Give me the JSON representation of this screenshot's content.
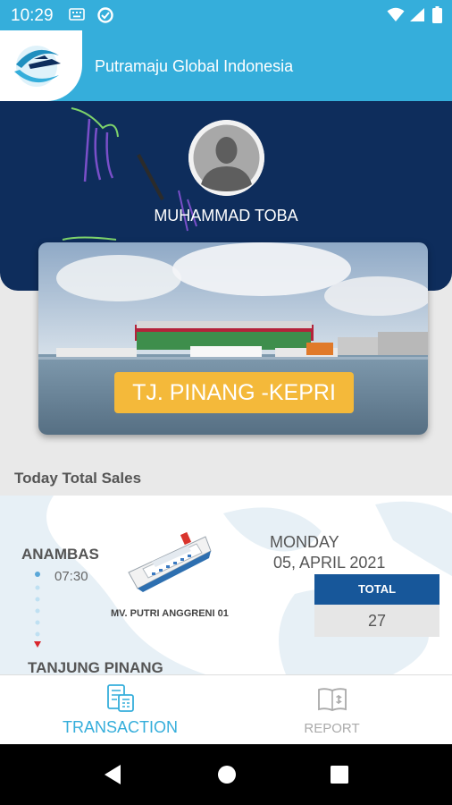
{
  "status_bar": {
    "time": "10:29",
    "icons": [
      "keyboard-icon",
      "data-saver-icon",
      "wifi-icon",
      "signal-icon",
      "battery-icon"
    ]
  },
  "app_bar": {
    "title": "Putramaju Global Indonesia",
    "logo": "ship-logo-icon"
  },
  "profile": {
    "name": "MUHAMMAD TOBA",
    "avatar_icon": "user-silhouette-icon"
  },
  "route_card": {
    "badge": "TJ. PINANG -KEPRI"
  },
  "sales": {
    "section_title": "Today Total Sales",
    "origin": "ANAMBAS",
    "departure_time": "07:30",
    "destination": "TANJUNG PINANG",
    "ship_name": "MV. PUTRI ANGGRENI 01",
    "day": "MONDAY",
    "date": "05, APRIL 2021",
    "total_label": "TOTAL",
    "total_value": "27"
  },
  "bottom_nav": {
    "items": [
      {
        "label": "TRANSACTION",
        "icon": "transaction-icon",
        "active": true
      },
      {
        "label": "REPORT",
        "icon": "report-icon",
        "active": false
      }
    ]
  },
  "colors": {
    "primary": "#35aedb",
    "header_navy": "#0e2d5c",
    "badge": "#f4b93a",
    "total_header": "#17579a"
  }
}
